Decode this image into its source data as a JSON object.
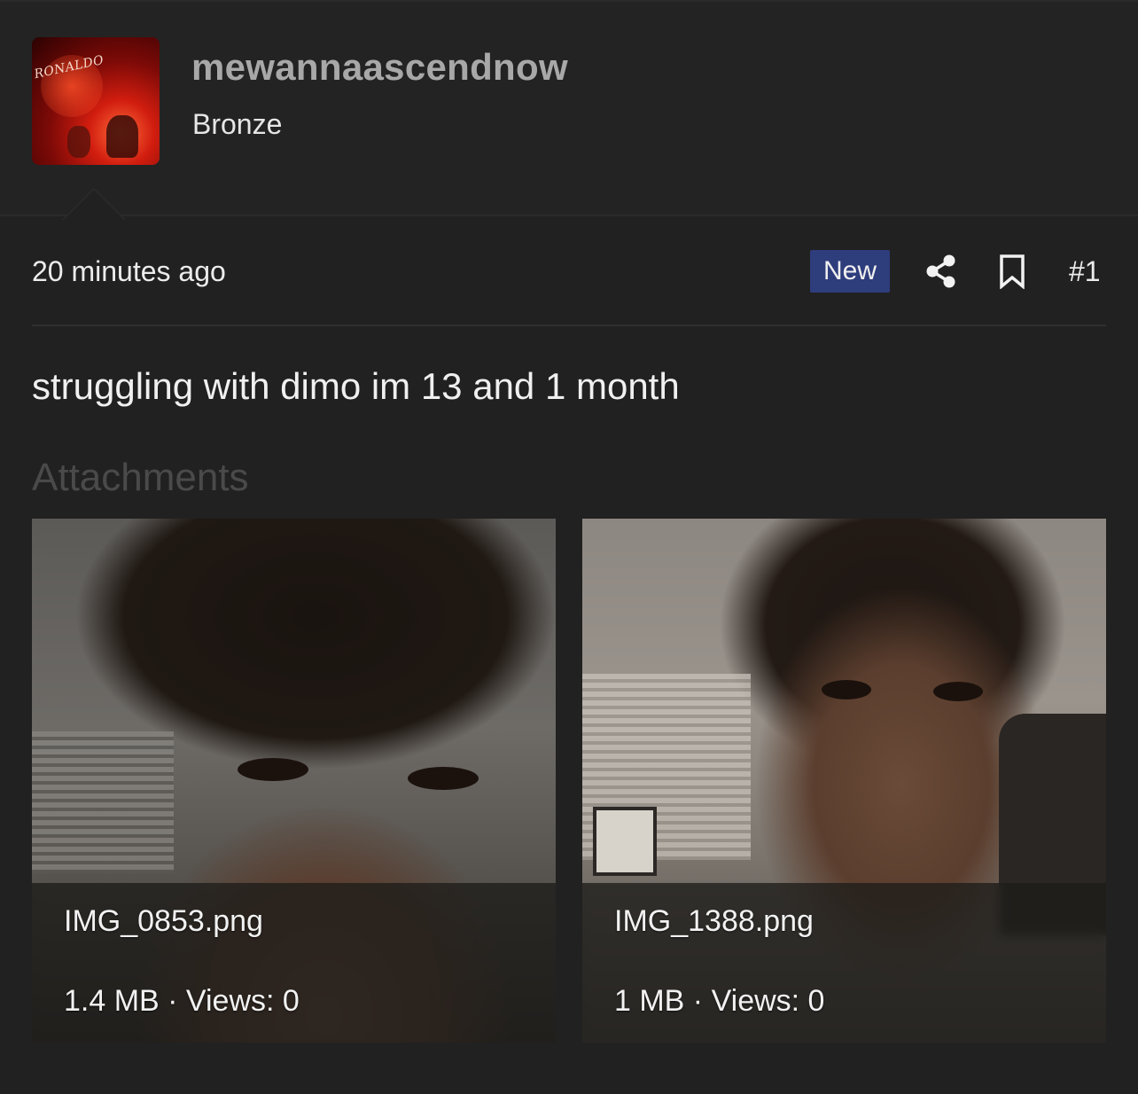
{
  "post": {
    "user": {
      "username": "mewannaascendnow",
      "rank": "Bronze",
      "avatar_text": "RONALDO"
    },
    "timestamp": "20 minutes ago",
    "badge": "New",
    "post_number": "#1",
    "icons": {
      "share": "share-icon",
      "bookmark": "bookmark-icon"
    },
    "body": "struggling with dimo im 13 and 1 month",
    "attachments_title": "Attachments",
    "attachments": [
      {
        "filename": "IMG_0853.png",
        "info": "1.4 MB · Views: 0"
      },
      {
        "filename": "IMG_1388.png",
        "info": "1 MB · Views: 0"
      }
    ]
  },
  "colors": {
    "background": "#212121",
    "badge": "#2e3d7c",
    "username": "#a8a8a8",
    "muted_heading": "#4a4a4a"
  }
}
